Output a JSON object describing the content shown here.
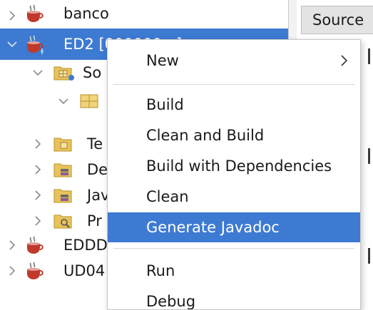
{
  "projects_tree": {
    "rows": [
      {
        "label": "banco",
        "expanded": false,
        "icon": "coffee-cup-project-icon"
      },
      {
        "label": "ED2 [000000...]",
        "expanded": true,
        "selected": true,
        "icon": "coffee-cup-project-icon"
      },
      {
        "label": "So",
        "expanded": true,
        "icon": "source-packages-folder-icon"
      },
      {
        "label": "",
        "expanded": true,
        "icon": "package-icon"
      },
      {
        "label": "Te",
        "expanded": false,
        "icon": "test-packages-folder-icon"
      },
      {
        "label": "De",
        "expanded": false,
        "icon": "dependencies-folder-icon"
      },
      {
        "label": "Jav",
        "expanded": false,
        "icon": "java-dependencies-folder-icon"
      },
      {
        "label": "Pr",
        "expanded": false,
        "icon": "project-files-folder-icon"
      },
      {
        "label": "EDDD",
        "expanded": false,
        "icon": "coffee-cup-project-icon"
      },
      {
        "label": "UD04",
        "expanded": false,
        "icon": "coffee-cup-project-icon"
      }
    ]
  },
  "editor": {
    "source_tab": "Source"
  },
  "context_menu": {
    "items": [
      {
        "label": "New",
        "submenu": true
      },
      {
        "label": "Build"
      },
      {
        "label": "Clean and Build"
      },
      {
        "label": "Build with Dependencies"
      },
      {
        "label": "Clean"
      },
      {
        "label": "Generate Javadoc",
        "highlighted": true
      },
      {
        "label": "Run"
      },
      {
        "label": "Debug"
      }
    ]
  },
  "colors": {
    "selection": "#3d7ad2",
    "menu_bg": "#ffffff",
    "folder": "#e8c35a",
    "coffee": "#c0392b"
  }
}
